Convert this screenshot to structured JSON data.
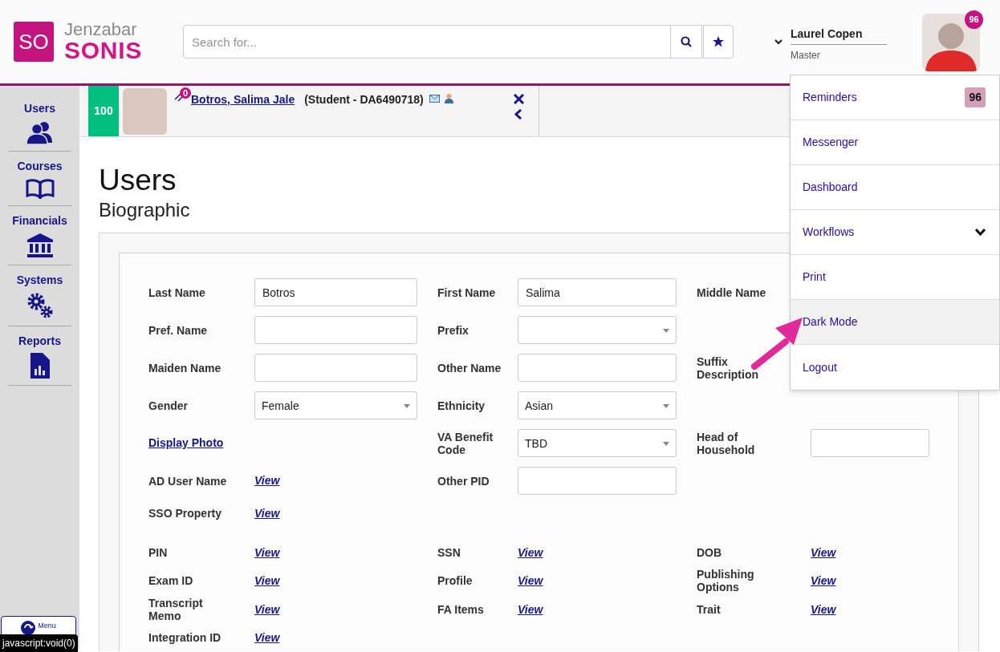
{
  "header": {
    "logo": {
      "mark": "SO",
      "brand": "Jenzabar",
      "product": "SONIS"
    },
    "search": {
      "placeholder": "Search for..."
    },
    "user": {
      "name": "Laurel Copen",
      "role": "Master",
      "notification_count": "96"
    }
  },
  "sidebar": {
    "items": [
      {
        "label": "Users"
      },
      {
        "label": "Courses"
      },
      {
        "label": "Financials"
      },
      {
        "label": "Systems"
      },
      {
        "label": "Reports"
      }
    ],
    "menu_button": "Menu"
  },
  "status_tooltip": "javascript:void(0)",
  "student": {
    "score": "100",
    "attachment_count": "0",
    "name": "Botros, Salima Jale",
    "descriptor": "(Student - DA6490718)"
  },
  "page": {
    "title": "Users",
    "subtitle": "Biographic"
  },
  "form": {
    "sections": [
      {
        "rows": [
          {
            "cells": [
              {
                "kind": "input",
                "label": "Last Name",
                "value": "Botros"
              },
              {
                "kind": "input",
                "label": "First Name",
                "value": "Salima"
              },
              {
                "kind": "label",
                "label": "Middle Name"
              }
            ]
          },
          {
            "cells": [
              {
                "kind": "input",
                "label": "Pref. Name"
              },
              {
                "kind": "select",
                "label": "Prefix"
              },
              {
                "kind": "blank"
              }
            ]
          },
          {
            "cells": [
              {
                "kind": "input",
                "label": "Maiden Name"
              },
              {
                "kind": "input",
                "label": "Other Name"
              },
              {
                "kind": "label",
                "label": "Suffix Description"
              }
            ]
          },
          {
            "cells": [
              {
                "kind": "select",
                "label": "Gender",
                "value": "Female"
              },
              {
                "kind": "select",
                "label": "Ethnicity",
                "value": "Asian"
              },
              {
                "kind": "blank"
              }
            ]
          },
          {
            "cells": [
              {
                "kind": "link",
                "label": "Display Photo"
              },
              {
                "kind": "select",
                "label": "VA Benefit Code",
                "value": "TBD"
              },
              {
                "kind": "input",
                "label": "Head of Household"
              }
            ]
          },
          {
            "cells": [
              {
                "kind": "view",
                "label": "AD User Name",
                "link": "View"
              },
              {
                "kind": "input",
                "label": "Other PID"
              },
              {
                "kind": "blank"
              }
            ]
          },
          {
            "cells": [
              {
                "kind": "view",
                "label": "SSO Property",
                "link": "View"
              },
              {
                "kind": "blank"
              },
              {
                "kind": "blank"
              }
            ]
          }
        ]
      },
      {
        "rows": [
          {
            "cells": [
              {
                "kind": "view",
                "label": "PIN",
                "link": "View"
              },
              {
                "kind": "view",
                "label": "SSN",
                "link": "View"
              },
              {
                "kind": "view",
                "label": "DOB",
                "link": "View"
              }
            ]
          },
          {
            "cells": [
              {
                "kind": "view",
                "label": "Exam ID",
                "link": "View"
              },
              {
                "kind": "view",
                "label": "Profile",
                "link": "View"
              },
              {
                "kind": "view",
                "label": "Publishing Options",
                "link": "View"
              }
            ]
          },
          {
            "cells": [
              {
                "kind": "view",
                "label": "Transcript Memo",
                "link": "View"
              },
              {
                "kind": "view",
                "label": "FA Items",
                "link": "View"
              },
              {
                "kind": "view",
                "label": "Trait",
                "link": "View"
              }
            ]
          },
          {
            "cells": [
              {
                "kind": "view",
                "label": "Integration ID",
                "link": "View"
              },
              {
                "kind": "blank"
              },
              {
                "kind": "blank"
              }
            ]
          }
        ]
      }
    ]
  },
  "user_menu": {
    "items": [
      {
        "label": "Reminders",
        "badge": "96",
        "selected": false
      },
      {
        "label": "Messenger",
        "selected": false
      },
      {
        "label": "Dashboard",
        "selected": false
      },
      {
        "label": "Workflows",
        "expanded": false,
        "selected": false
      },
      {
        "label": "Print",
        "selected": false
      },
      {
        "label": "Dark Mode",
        "selected": true
      },
      {
        "label": "Logout",
        "selected": false
      }
    ]
  }
}
